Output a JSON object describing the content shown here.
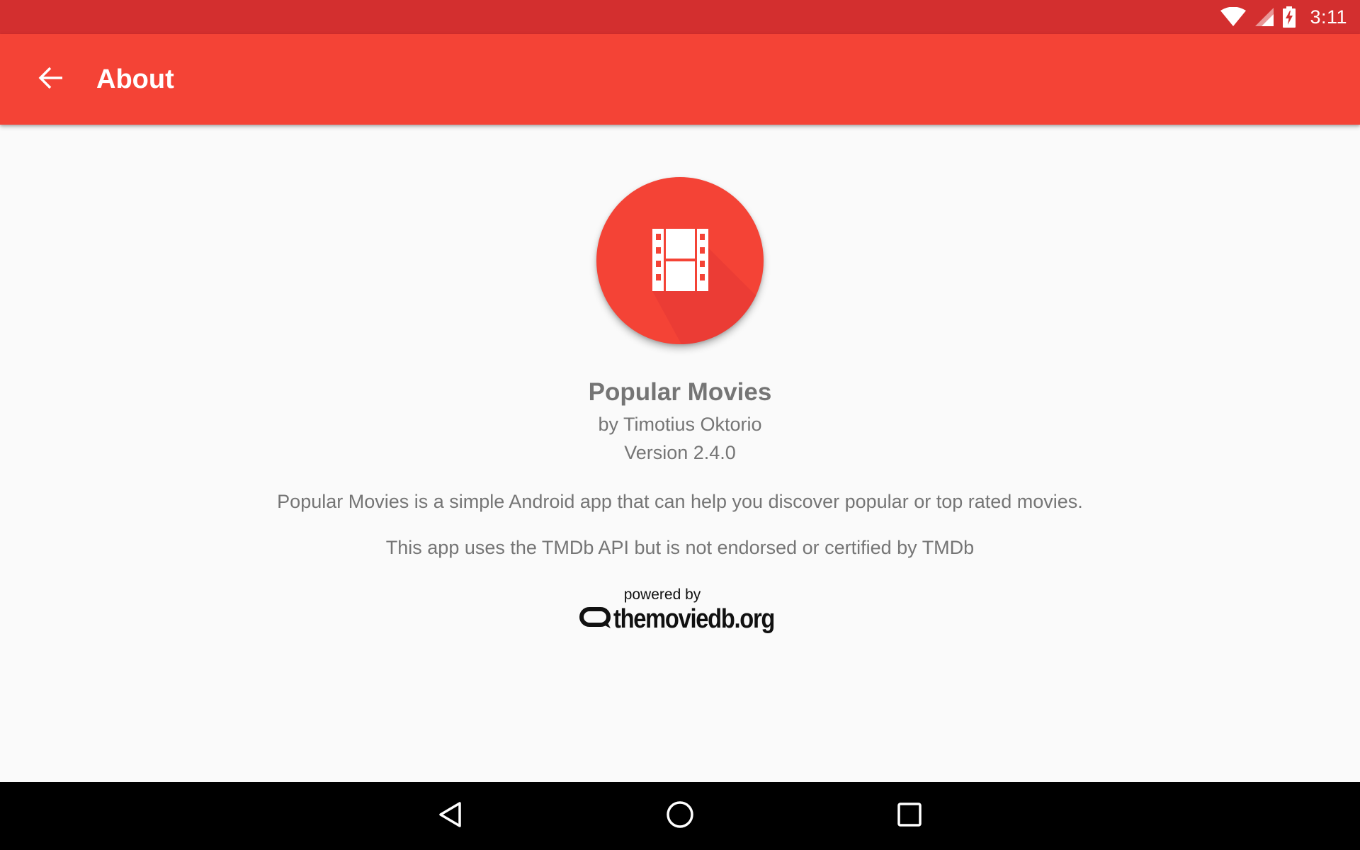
{
  "status_bar": {
    "time": "3:11",
    "icons": [
      "wifi-icon",
      "cell-signal-icon",
      "battery-charging-icon"
    ]
  },
  "toolbar": {
    "back_icon": "arrow-back-icon",
    "title": "About"
  },
  "about": {
    "app_icon": "movie-film-icon",
    "app_name": "Popular Movies",
    "author": "by Timotius Oktorio",
    "version": "Version 2.4.0",
    "description": "Popular Movies is a simple Android app that can help you discover popular or top rated movies.",
    "disclaimer": "This app uses the TMDb API but is not endorsed or certified by TMDb",
    "tmdb_powered_by": "powered by",
    "tmdb_wordmark": "themoviedb.org"
  },
  "nav_bar": {
    "buttons": [
      "back-nav-icon",
      "home-nav-icon",
      "recents-nav-icon"
    ]
  },
  "colors": {
    "status_bar": "#d32f2f",
    "toolbar": "#f44336",
    "background": "#fafafa",
    "text_secondary": "#757575",
    "nav_bar": "#000000"
  }
}
